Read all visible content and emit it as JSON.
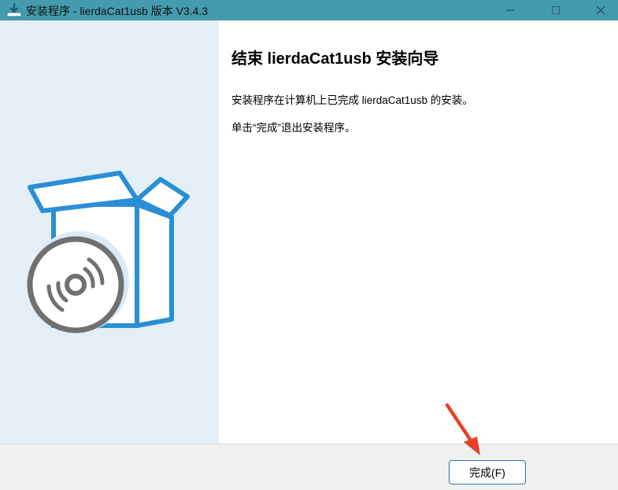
{
  "window": {
    "title": "安装程序 - lierdaCat1usb 版本 V3.4.3",
    "titlebar_color": "#449bae",
    "minimize_icon": "minimize-icon",
    "maximize_icon": "maximize-icon",
    "close_icon": "close-icon"
  },
  "wizard": {
    "heading": "结束 lierdaCat1usb 安装向导",
    "message": "安装程序在计算机上已完成 lierdaCat1usb 的安装。",
    "instruction": "单击“完成”退出安装程序。"
  },
  "footer": {
    "finish_label": "完成(F)"
  },
  "art": {
    "box_color": "#2a8fd4",
    "disc_color": "#707070",
    "side_panel_color": "#e3eef7"
  },
  "annotation": {
    "arrow_color": "#e8402a"
  }
}
